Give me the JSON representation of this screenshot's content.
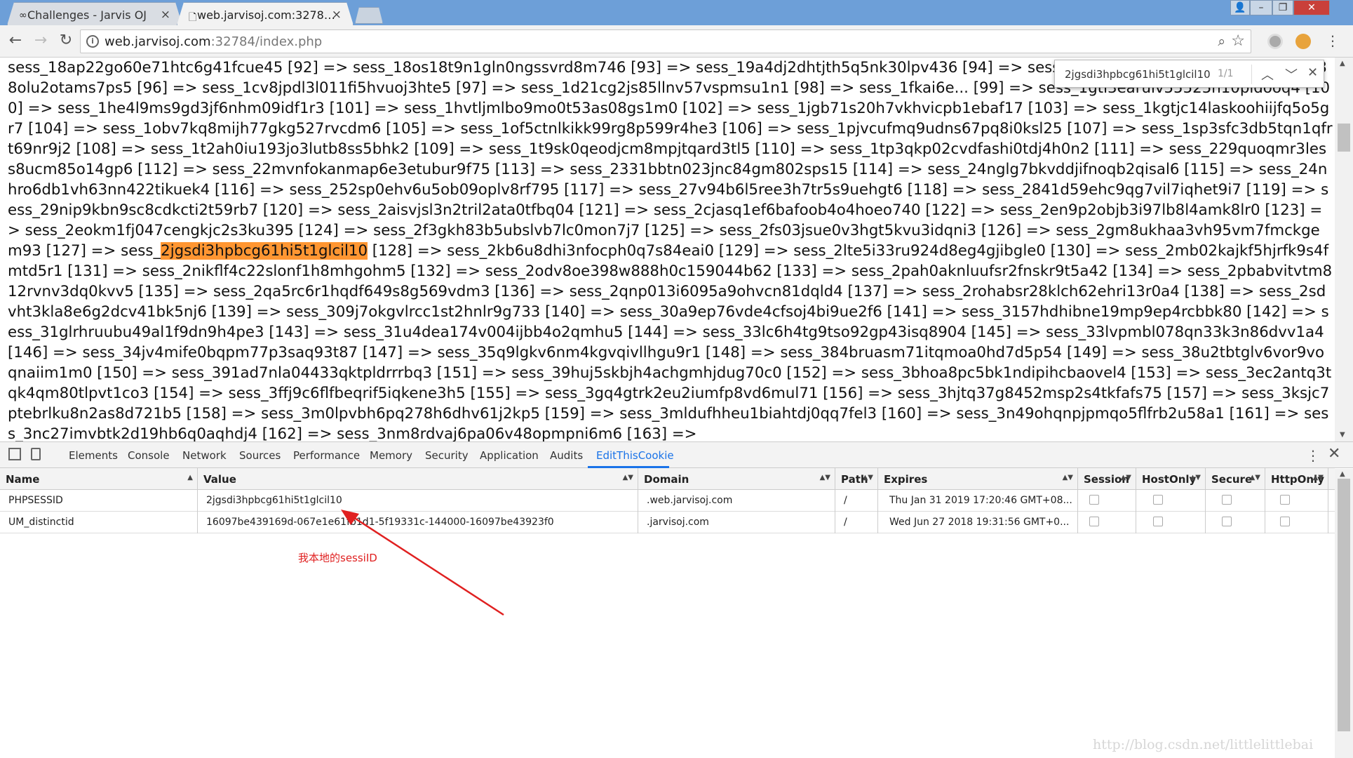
{
  "tabs": [
    {
      "title": "Challenges - Jarvis OJ"
    },
    {
      "title": "web.jarvisoj.com:3278…"
    }
  ],
  "address": {
    "url_host": "web.jarvisoj.com",
    "url_rest": ":32784/index.php"
  },
  "page_text_before": "sess_18ap22go60e71htc6g41fcue45 [92] => sess_18os18t9n1gln0ngssvrd8m746 [93] => sess_19a4dj2dhtjth5q5nk30lpv436 [94] => sess_1bih... [95] => sess_1bjpc39f75v88olu2otams7ps5 [96] => sess_1cv8jpdl3l011fi5hvuoj3hte5 [97] => sess_1d21cg2js85llnv57vspmsu1n1 [98] => sess_1fkai6e... [99] => sess_1gtl3earuiv55525n10pldooq4 [100] => sess_1he4l9ms9gd3jf6nhm09idf1r3 [101] => sess_1hvtljmlbo9mo0t53as08gs1m0 [102] => sess_1jgb71s20h7vkhvicpb1ebaf17 [103] => sess_1kgtjc14laskoohiijfq5o5gr7 [104] => sess_1obv7kq8mijh77gkg527rvcdm6 [105] => sess_1of5ctnlkikk99rg8p599r4he3 [106] => sess_1pjvcufmq9udns67pq8i0ksl25 [107] => sess_1sp3sfc3db5tqn1qfrt69nr9j2 [108] => sess_1t2ah0iu193jo3lutb8ss5bhk2 [109] => sess_1t9sk0qeodjcm8mpjtqard3tl5 [110] => sess_1tp3qkp02cvdfashi0tdj4h0n2 [111] => sess_229quoqmr3less8ucm85o14gp6 [112] => sess_22mvnfokanmap6e3etubur9f75 [113] => sess_2331bbtn023jnc84gm802sps15 [114] => sess_24nglg7bkvddjifnoqb2qisal6 [115] => sess_24nhro6db1vh63nn422tikuek4 [116] => sess_252sp0ehv6u5ob09oplv8rf795 [117] => sess_27v94b6l5ree3h7tr5s9uehgt6 [118] => sess_2841d59ehc9qg7vil7iqhet9i7 [119] => sess_29nip9kbn9sc8cdkcti2t59rb7 [120] => sess_2aisvjsl3n2tril2ata0tfbq04 [121] => sess_2cjasq1ef6bafoob4o4hoeo740 [122] => sess_2en9p2objb3i97lb8l4amk8lr0 [123] => sess_2eokm1fj047cengkjc2s3ku395 [124] => sess_2f3gkh83b5ubslvb7lc0mon7j7 [125] => sess_2fs03jsue0v3hgt5kvu3idqni3 [126] => sess_2gm8ukhaa3vh95vm7fmckgem93 [127] => sess_",
  "page_text_highlight": "2jgsdi3hpbcg61hi5t1glcil10",
  "page_text_after": " [128] => sess_2kb6u8dhi3nfocph0q7s84eai0 [129] => sess_2lte5i33ru924d8eg4gjibgle0 [130] => sess_2mb02kajkf5hjrfk9s4fmtd5r1 [131] => sess_2nikflf4c22slonf1h8mhgohm5 [132] => sess_2odv8oe398w888h0c159044b62 [133] => sess_2pah0aknluufsr2fnskr9t5a42 [134] => sess_2pbabvitvtm812rvnv3dq0kvv5 [135] => sess_2qa5rc6r1hqdf649s8g569vdm3 [136] => sess_2qnp013i6095a9ohvcn81dqld4 [137] => sess_2rohabsr28klch62ehri13r0a4 [138] => sess_2sdvht3kla8e6g2dcv41bk5nj6 [139] => sess_309j7okgvlrcc1st2hnlr9g733 [140] => sess_30a9ep76vde4cfsoj4bi9ue2f6 [141] => sess_3157hdhibne19mp9ep4rcbbk80 [142] => sess_31glrhruubu49al1f9dn9h4pe3 [143] => sess_31u4dea174v004ijbb4o2qmhu5 [144] => sess_33lc6h4tg9tso92gp43isq8904 [145] => sess_33lvpmbl078qn33k3n86dvv1a4 [146] => sess_34jv4mife0bqpm77p3saq93t87 [147] => sess_35q9lgkv6nm4kgvqivllhgu9r1 [148] => sess_384bruasm71itqmoa0hd7d5p54 [149] => sess_38u2tbtglv6vor9voqnaiim1m0 [150] => sess_391ad7nla04433qktpldrrrbq3 [151] => sess_39huj5skbjh4achgmhjdug70c0 [152] => sess_3bhoa8pc5bk1ndipihcbaovel4 [153] => sess_3ec2antq3tqk4qm80tlpvt1co3 [154] => sess_3ffj9c6flfbeqrif5iqkene3h5 [155] => sess_3gq4gtrk2eu2iumfp8vd6mul71 [156] => sess_3hjtq37g8452msp2s4tkfafs75 [157] => sess_3ksjc7ptebrlku8n2as8d721b5 [158] => sess_3m0lpvbh6pq278h6dhv61j2kp5 [159] => sess_3mldufhheu1biahtdj0qq7fel3 [160] => sess_3n49ohqnpjpmqo5flfrb2u58a1 [161] => sess_3nc27imvbtk2d19hb6q0aqhdj4 [162] => sess_3nm8rdvaj6pa06v48opmpni6m6 [163] =>",
  "findbar": {
    "query": "2jgsdi3hpbcg61hi5t1glcil10",
    "count": "1/1"
  },
  "devtools": {
    "tabs": [
      "Elements",
      "Console",
      "Network",
      "Sources",
      "Performance",
      "Memory",
      "Security",
      "Application",
      "Audits",
      "EditThisCookie"
    ],
    "active_tab": "EditThisCookie",
    "columns": [
      "Name",
      "Value",
      "Domain",
      "Path",
      "Expires",
      "Session",
      "HostOnly",
      "Secure",
      "HttpOnly"
    ],
    "cookies": [
      {
        "name": "PHPSESSID",
        "value": "2jgsdi3hpbcg61hi5t1glcil10",
        "domain": ".web.jarvisoj.com",
        "path": "/",
        "expires": "Thu Jan 31 2019 17:20:46 GMT+08..."
      },
      {
        "name": "UM_distinctid",
        "value": "16097be439169d-067e1e61fb1d1-5f19331c-144000-16097be43923f0",
        "domain": ".jarvisoj.com",
        "path": "/",
        "expires": "Wed Jun 27 2018 19:31:56 GMT+0..."
      }
    ]
  },
  "annotation": "我本地的sessiID",
  "watermark": "http://blog.csdn.net/littlelittlebai",
  "colors": {
    "highlight": "#ff9632",
    "annotation": "#e02020",
    "accent": "#1a73e8"
  }
}
